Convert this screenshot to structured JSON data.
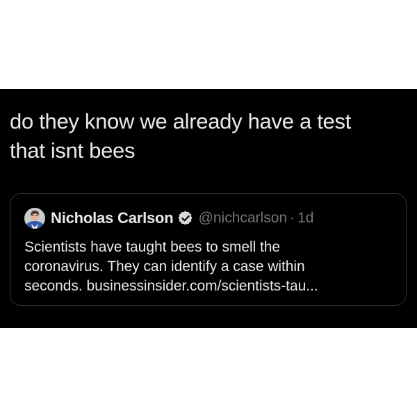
{
  "tweet": {
    "text_line1": "do they know we already have a test",
    "text_line2": "that isnt bees"
  },
  "quote": {
    "author_name": "Nicholas Carlson",
    "handle": "@nichcarlson",
    "separator": "·",
    "age": "1d",
    "avatar_icon": "avatar",
    "verified_icon": "verified-badge-icon",
    "body_line1": "Scientists have taught bees to smell the",
    "body_line2": "coronavirus. They can identify a case within",
    "body_line3_prefix": "seconds. ",
    "link_text": "businessinsider.com/scientists-tau..."
  },
  "colors": {
    "background": "#000000",
    "text": "#e7e9ea",
    "secondary_text": "#71767b",
    "card_border": "#2f3336",
    "verified": "#d9d9d9"
  }
}
